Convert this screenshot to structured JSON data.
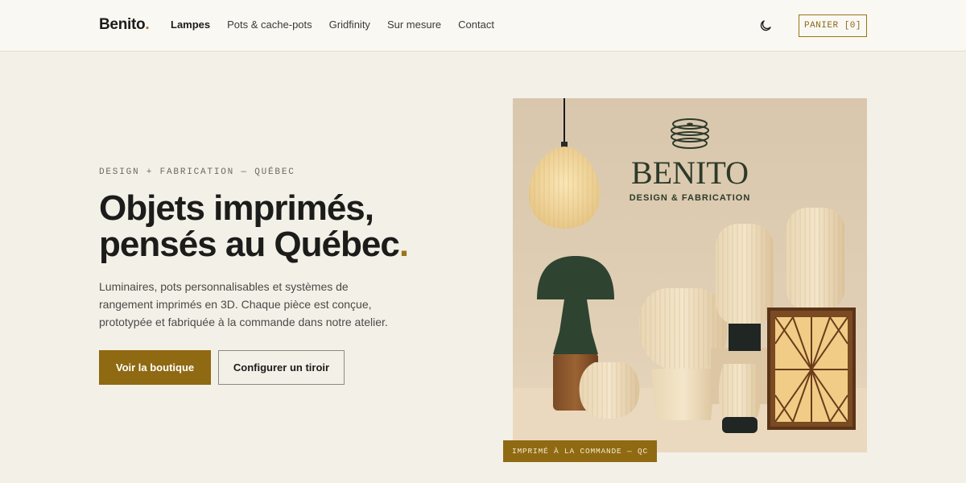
{
  "brand": {
    "name": "Benito",
    "dot": "."
  },
  "nav": {
    "items": [
      {
        "label": "Lampes",
        "active": true
      },
      {
        "label": "Pots & cache-pots",
        "active": false
      },
      {
        "label": "Gridfinity",
        "active": false
      },
      {
        "label": "Sur mesure",
        "active": false
      },
      {
        "label": "Contact",
        "active": false
      }
    ]
  },
  "header": {
    "theme_icon": "moon-icon",
    "cart_label": "PANIER [0]"
  },
  "hero": {
    "eyebrow": "DESIGN + FABRICATION — QUÉBEC",
    "headline_line1": "Objets imprimés,",
    "headline_line2": "pensés au Québec",
    "headline_dot": ".",
    "lead": "Luminaires, pots personnalisables et systèmes de rangement imprimés en 3D. Chaque pièce est conçue, prototypée et fabriquée à la commande dans notre atelier.",
    "primary_cta": "Voir la boutique",
    "secondary_cta": "Configurer un tiroir"
  },
  "image": {
    "brand_wordmark": "BENITO",
    "brand_tagline": "DESIGN & FABRICATION",
    "badge": "IMPRIMÉ À LA COMMANDE — QC"
  },
  "colors": {
    "accent": "#8f6a12",
    "background": "#f3f0e8",
    "header_bg": "#faf8f3",
    "text": "#1c1c1a"
  }
}
